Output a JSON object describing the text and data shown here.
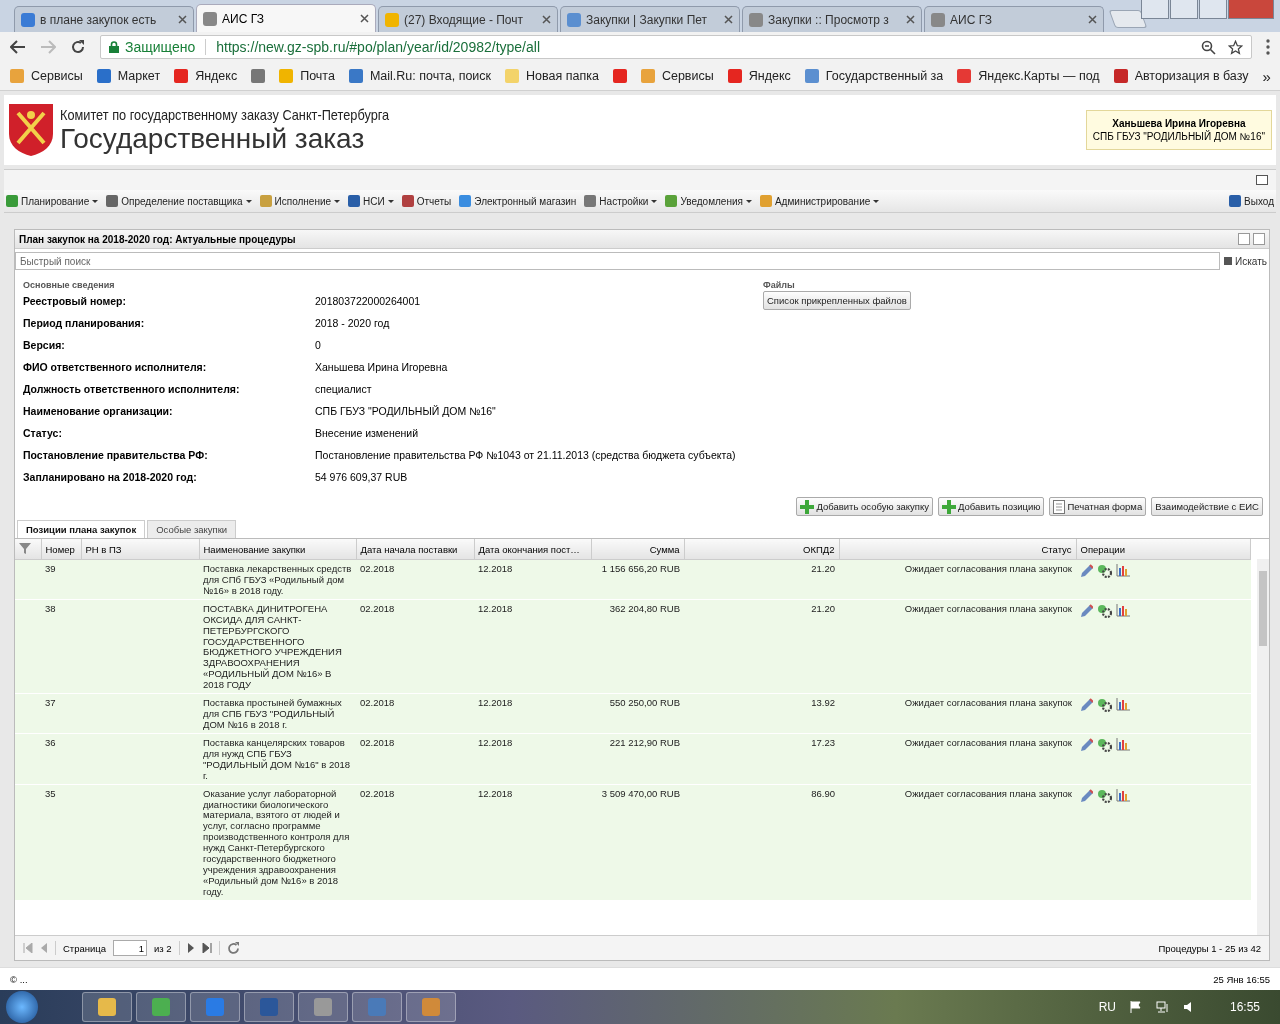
{
  "browser": {
    "tabs": [
      {
        "title": "в плане закупок есть",
        "selected": false
      },
      {
        "title": "АИС ГЗ",
        "selected": true
      },
      {
        "title": "(27) Входящие - Почт",
        "selected": false
      },
      {
        "title": "Закупки | Закупки Пет",
        "selected": false
      },
      {
        "title": "Закупки :: Просмотр з",
        "selected": false
      },
      {
        "title": "АИС ГЗ",
        "selected": false
      }
    ],
    "secure_label": "Защищено",
    "url": "https://new.gz-spb.ru/#po/plan/year/id/20982/type/all",
    "bookmarks": [
      {
        "kind": "link",
        "label": "Сервисы"
      },
      {
        "kind": "link",
        "label": "Маркет"
      },
      {
        "kind": "link",
        "label": "Яндекс"
      },
      {
        "kind": "icon"
      },
      {
        "kind": "link",
        "label": "Почта"
      },
      {
        "kind": "link",
        "label": "Mail.Ru: почта, поиск"
      },
      {
        "kind": "link",
        "label": "Новая папка"
      },
      {
        "kind": "icon"
      },
      {
        "kind": "link",
        "label": "Сервисы"
      },
      {
        "kind": "link",
        "label": "Яндекс"
      },
      {
        "kind": "link",
        "label": "Государственный за"
      },
      {
        "kind": "link",
        "label": "Яндекс.Карты — под"
      },
      {
        "kind": "link",
        "label": "Авторизация в базу"
      }
    ],
    "bookmarks_more": "»"
  },
  "header": {
    "org": "Комитет по государственному заказу Санкт-Петербурга",
    "title": "Государственный заказ",
    "user": {
      "name": "Ханьшева Ирина Игоревна",
      "org": "СПБ ГБУЗ \"РОДИЛЬНЫЙ ДОМ №16\""
    }
  },
  "menu": {
    "items": [
      {
        "label": "Планирование",
        "dropdown": true
      },
      {
        "label": "Определение поставщика",
        "dropdown": true
      },
      {
        "label": "Исполнение",
        "dropdown": true
      },
      {
        "label": "НСИ",
        "dropdown": true
      },
      {
        "label": "Отчеты",
        "dropdown": false
      },
      {
        "label": "Электронный магазин",
        "dropdown": false
      },
      {
        "label": "Настройки",
        "dropdown": true
      },
      {
        "label": "Уведомления",
        "dropdown": true
      },
      {
        "label": "Администрирование",
        "dropdown": true
      }
    ],
    "logout": "Выход"
  },
  "panel": {
    "title": "План закупок на 2018-2020 год: Актуальные процедуры",
    "search": {
      "placeholder": "Быстрый поиск",
      "button": "Искать"
    },
    "section": "Основные сведения",
    "fields": [
      {
        "label": "Реестровый номер:",
        "value": "201803722000264001"
      },
      {
        "label": "Период планирования:",
        "value": "2018 - 2020 год"
      },
      {
        "label": "Версия:",
        "value": "0"
      },
      {
        "label": "ФИО ответственного исполнителя:",
        "value": "Ханьшева Ирина Игоревна"
      },
      {
        "label": "Должность ответственного исполнителя:",
        "value": "специалист"
      },
      {
        "label": "Наименование организации:",
        "value": "СПБ ГБУЗ \"РОДИЛЬНЫЙ ДОМ №16\""
      },
      {
        "label": "Статус:",
        "value": "Внесение изменений"
      },
      {
        "label": "Постановление правительства РФ:",
        "value": "Постановление правительства РФ №1043 от 21.11.2013 (средства бюджета субъекта)"
      },
      {
        "label": "Запланировано на 2018-2020 год:",
        "value": "54 976 609,37 RUB"
      }
    ],
    "files": {
      "title": "Файлы",
      "button": "Список прикрепленных файлов"
    },
    "actions": [
      {
        "label": "Добавить особую закупку",
        "kind": "add"
      },
      {
        "label": "Добавить позицию",
        "kind": "add"
      },
      {
        "label": "Печатная форма",
        "kind": "print"
      },
      {
        "label": "Взаимодействие с ЕИС",
        "kind": "plain"
      }
    ],
    "tabs": [
      {
        "label": "Позиции плана закупок",
        "selected": true
      },
      {
        "label": "Особые закупки",
        "selected": false
      }
    ],
    "columns": [
      "Номер",
      "РН в ПЗ",
      "Наименование закупки",
      "Дата начала поставки",
      "Дата окончания пост…",
      "Сумма",
      "ОКПД2",
      "Статус",
      "Операции"
    ],
    "rows": [
      {
        "number": "39",
        "name": "Поставка лекарственных средств для СПб ГБУЗ «Родильный дом №16» в 2018 году.",
        "start": "02.2018",
        "end": "12.2018",
        "sum": "1 156 656,20 RUB",
        "okpd": "21.20",
        "status": "Ожидает согласования плана закупок"
      },
      {
        "number": "38",
        "name": "ПОСТАВКА ДИНИТРОГЕНА ОКСИДА ДЛЯ САНКТ-ПЕТЕРБУРГСКОГО ГОСУДАРСТВЕННОГО БЮДЖЕТНОГО УЧРЕЖДЕНИЯ ЗДРАВООХРАНЕНИЯ «РОДИЛЬНЫЙ ДОМ №16» В 2018 ГОДУ",
        "start": "02.2018",
        "end": "12.2018",
        "sum": "362 204,80 RUB",
        "okpd": "21.20",
        "status": "Ожидает согласования плана закупок"
      },
      {
        "number": "37",
        "name": "Поставка простыней бумажных для СПБ ГБУЗ \"РОДИЛЬНЫЙ ДОМ №16 в 2018 г.",
        "start": "02.2018",
        "end": "12.2018",
        "sum": "550 250,00 RUB",
        "okpd": "13.92",
        "status": "Ожидает согласования плана закупок"
      },
      {
        "number": "36",
        "name": "Поставка канцелярских товаров для нужд СПБ ГБУЗ \"РОДИЛЬНЫЙ ДОМ №16\" в 2018 г.",
        "start": "02.2018",
        "end": "12.2018",
        "sum": "221 212,90 RUB",
        "okpd": "17.23",
        "status": "Ожидает согласования плана закупок"
      },
      {
        "number": "35",
        "name": "Оказание услуг лабораторной диагностики биологического материала, взятого от людей и услуг, согласно программе производственного контроля для нужд Санкт-Петербургского государственного бюджетного учреждения здравоохранения «Родильный дом №16» в 2018 году.",
        "start": "02.2018",
        "end": "12.2018",
        "sum": "3 509 470,00 RUB",
        "okpd": "86.90",
        "status": "Ожидает согласования плана закупок"
      }
    ],
    "pager": {
      "page_label": "Страница",
      "page": "1",
      "of": "из 2",
      "summary": "Процедуры 1 - 25 из 42"
    }
  },
  "status_bar": {
    "left": "© ...",
    "right": "25 Янв 16:55"
  },
  "taskbar": {
    "lang": "RU",
    "time": "16:55"
  }
}
